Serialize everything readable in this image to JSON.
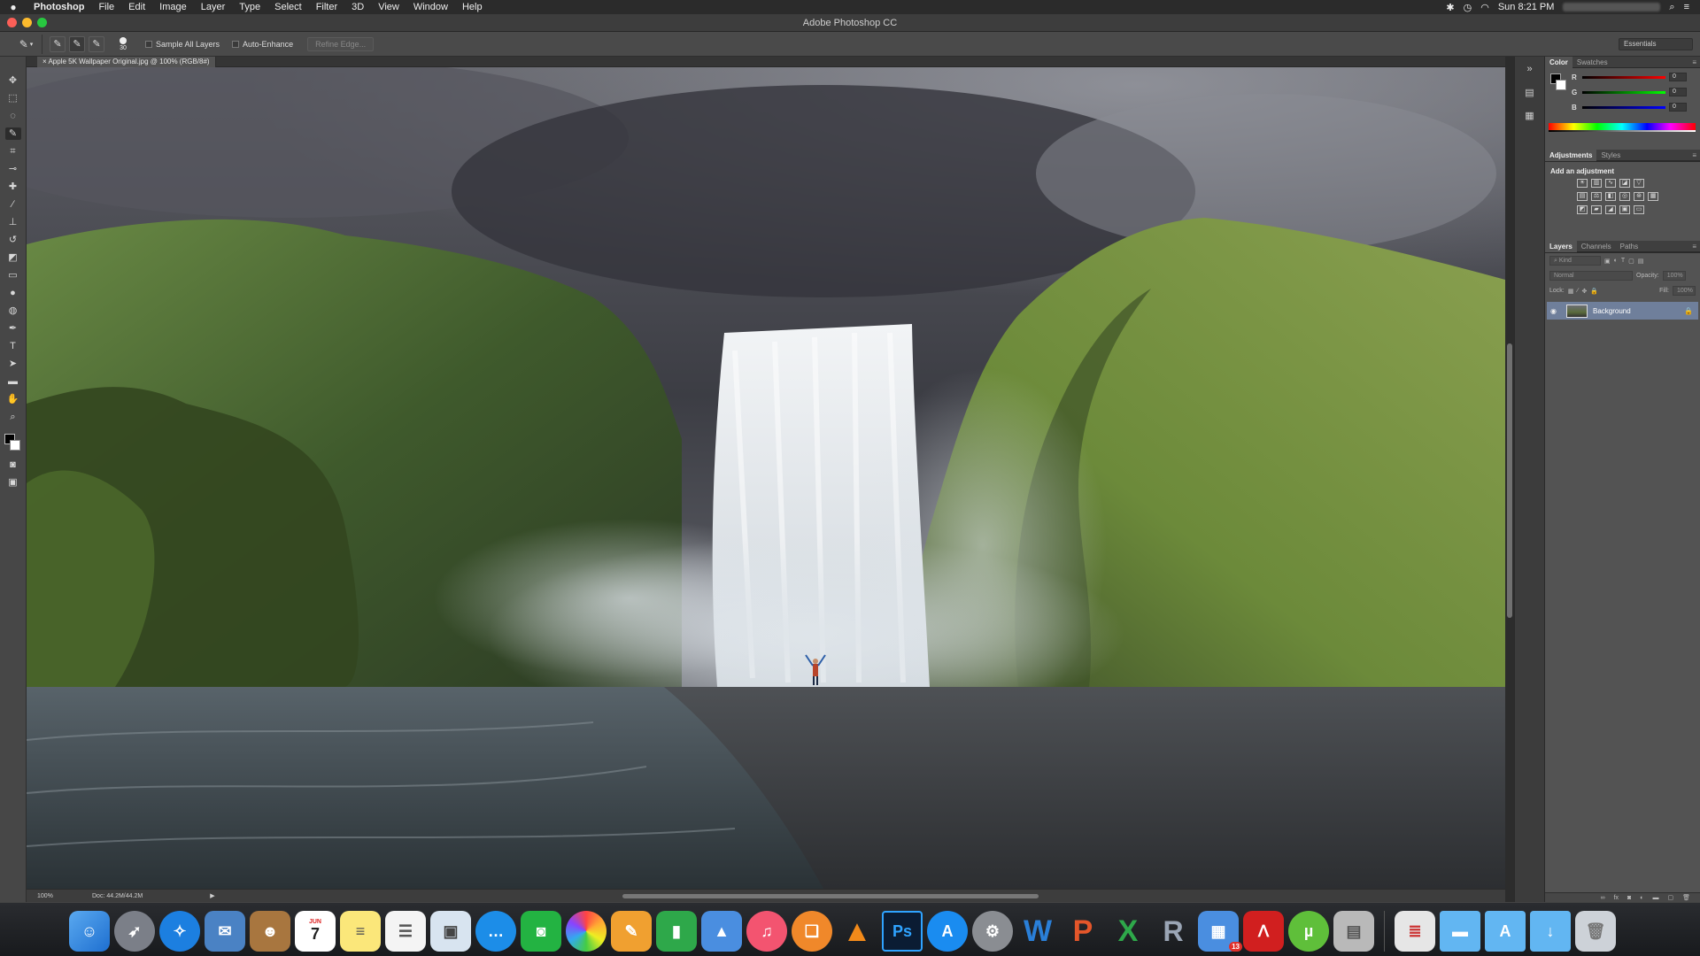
{
  "menubar": {
    "apple": "",
    "items": [
      "Photoshop",
      "File",
      "Edit",
      "Image",
      "Layer",
      "Type",
      "Select",
      "Filter",
      "3D",
      "View",
      "Window",
      "Help"
    ],
    "clock": "Sun 8:21 PM"
  },
  "window": {
    "title": "Adobe Photoshop CC"
  },
  "options": {
    "brush_size": "30",
    "sample_all_layers": "Sample All Layers",
    "auto_enhance": "Auto-Enhance",
    "refine_edge": "Refine Edge...",
    "workspace": "Essentials"
  },
  "document": {
    "tab_title": "Apple 5K Wallpaper Original.jpg @ 100% (RGB/8#)",
    "zoom": "100%",
    "doc_info": "Doc: 44.2M/44.2M"
  },
  "panels": {
    "color_tabs": [
      "Color",
      "Swatches"
    ],
    "color_values": {
      "r": "0",
      "g": "0",
      "b": "0"
    },
    "slider_labels": {
      "r": "R",
      "g": "G",
      "b": "B"
    },
    "adjust_tabs": [
      "Adjustments",
      "Styles"
    ],
    "adjust_title": "Add an adjustment",
    "layer_tabs": [
      "Layers",
      "Channels",
      "Paths"
    ],
    "kind_label": "Kind",
    "blend_mode": "Normal",
    "opacity_label": "Opacity:",
    "opacity_value": "100%",
    "lock_label": "Lock:",
    "fill_label": "Fill:",
    "fill_value": "100%",
    "layer_name": "Background"
  },
  "dock": {
    "calendar_month": "JUN",
    "calendar_day": "7",
    "ps_label": "Ps",
    "badge_count": "13",
    "apps": [
      "finder-icon",
      "launchpad-icon",
      "safari-icon",
      "mail-icon",
      "contacts-icon",
      "calendar-icon",
      "notes-icon",
      "reminders-icon",
      "preview-icon",
      "messages-icon",
      "facetime-icon",
      "photos-icon",
      "pages-icon",
      "numbers-icon",
      "keynote-icon",
      "itunes-icon",
      "ibooks-icon",
      "vlc-icon",
      "photoshop-icon",
      "appstore-icon",
      "systemprefs-icon",
      "word-icon",
      "powerpoint-icon",
      "excel-icon",
      "r-icon",
      "parallels-icon",
      "acrobat-icon",
      "utorrent-icon",
      "archive-icon",
      "pdf-doc-icon",
      "folder-icon",
      "applications-folder-icon",
      "downloads-folder-icon",
      "trash-icon"
    ]
  }
}
